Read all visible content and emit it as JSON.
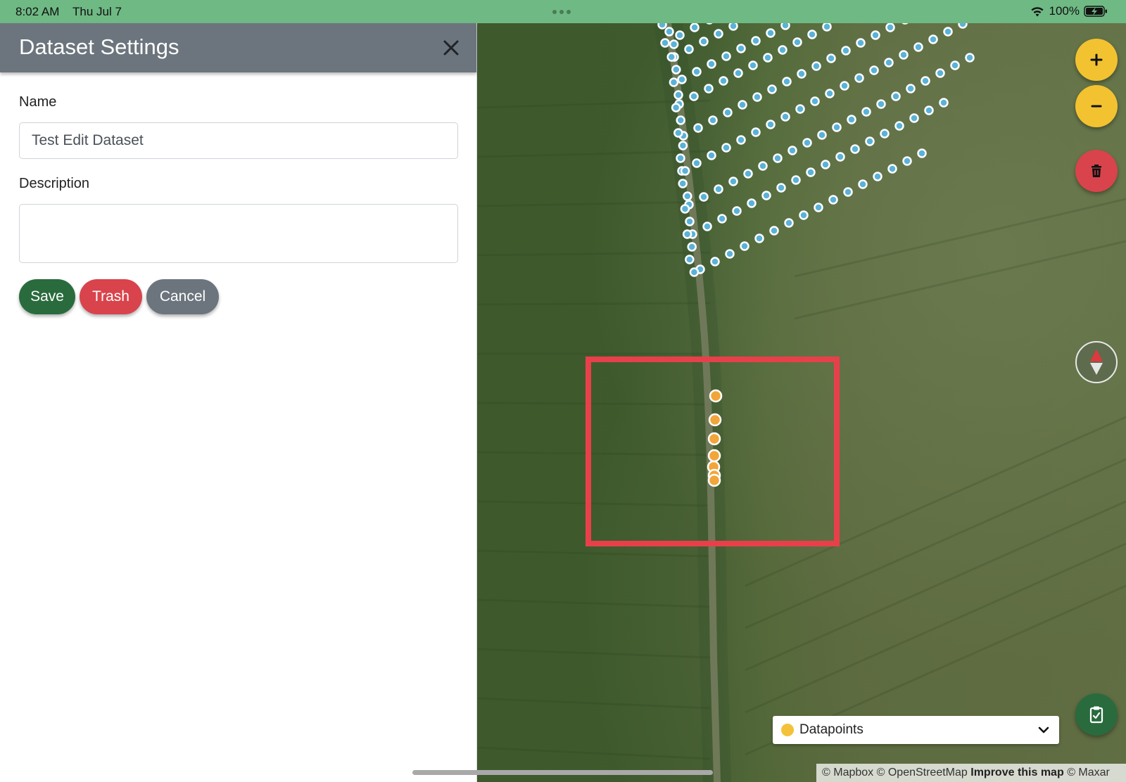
{
  "status_bar": {
    "time": "8:02 AM",
    "date": "Thu Jul 7",
    "battery": "100%"
  },
  "panel": {
    "title": "Dataset Settings",
    "close_icon": "close-icon",
    "name_label": "Name",
    "name_value": "Test Edit Dataset",
    "description_label": "Description",
    "description_value": "",
    "buttons": {
      "save": "Save",
      "trash": "Trash",
      "cancel": "Cancel"
    }
  },
  "map": {
    "controls": {
      "zoom_in": "plus-icon",
      "zoom_out": "minus-icon",
      "delete": "trash-icon",
      "compass": "compass-icon",
      "clipboard": "clipboard-check-icon"
    },
    "layer_selector": {
      "label": "Datapoints",
      "dot_color": "#f4c23a"
    },
    "attribution": {
      "mapbox": "© Mapbox",
      "osm": "© OpenStreetMap",
      "improve": "Improve this map",
      "maxar": "© Maxar"
    },
    "colors": {
      "selection_box": "#e8404a",
      "point_blue": "#5bb2d8",
      "point_orange": "#f2a53a"
    }
  }
}
